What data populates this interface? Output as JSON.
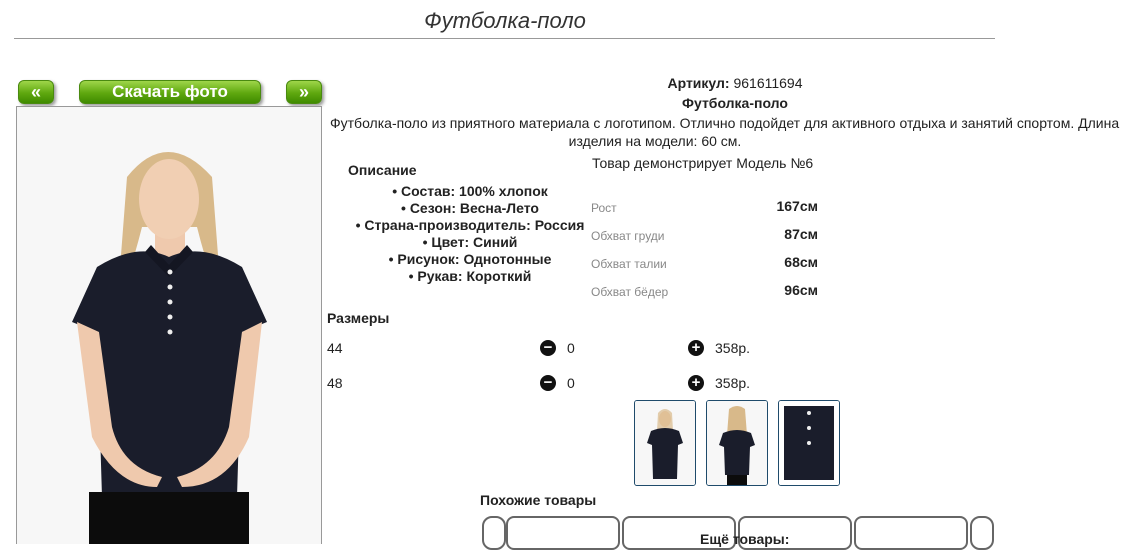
{
  "page": {
    "title": "Футболка-поло"
  },
  "gallery": {
    "prev_label": "«",
    "download_label": "Скачать фото",
    "next_label": "»"
  },
  "product": {
    "article_label": "Артикул:",
    "article_value": "961611694",
    "name": "Футболка-поло",
    "description_line1": "Футболка-поло из приятного материала с логотипом. Отлично подойдет для активного отдыха и занятий спортом. Длина",
    "description_line2": "изделия на модели: 60 см."
  },
  "description": {
    "heading": "Описание",
    "items": [
      "• Состав: 100% хлопок",
      "• Сезон: Весна-Лето",
      "• Страна-производитель: Россия",
      "• Цвет: Синий",
      "• Рисунок: Однотонные",
      "• Рукав: Короткий"
    ]
  },
  "model": {
    "heading": "Товар демонстрирует Модель №6",
    "params": [
      {
        "label": "Рост",
        "value": "167см"
      },
      {
        "label": "Обхват груди",
        "value": "87см"
      },
      {
        "label": "Обхват талии",
        "value": "68см"
      },
      {
        "label": "Обхват бёдер",
        "value": "96см"
      }
    ]
  },
  "sizes": {
    "heading": "Размеры",
    "rows": [
      {
        "size": "44",
        "qty": "0",
        "price": "358р."
      },
      {
        "size": "48",
        "qty": "0",
        "price": "358р."
      }
    ]
  },
  "icons": {
    "minus": "minus-circle-icon",
    "plus": "plus-circle-icon"
  },
  "similar": {
    "heading": "Похожие товары"
  },
  "more": {
    "heading": "Ещё товары:"
  },
  "colors": {
    "button_green": "#5fa80f",
    "shirt_navy": "#1a1d2b",
    "thumb_border": "#1f4b6b"
  }
}
